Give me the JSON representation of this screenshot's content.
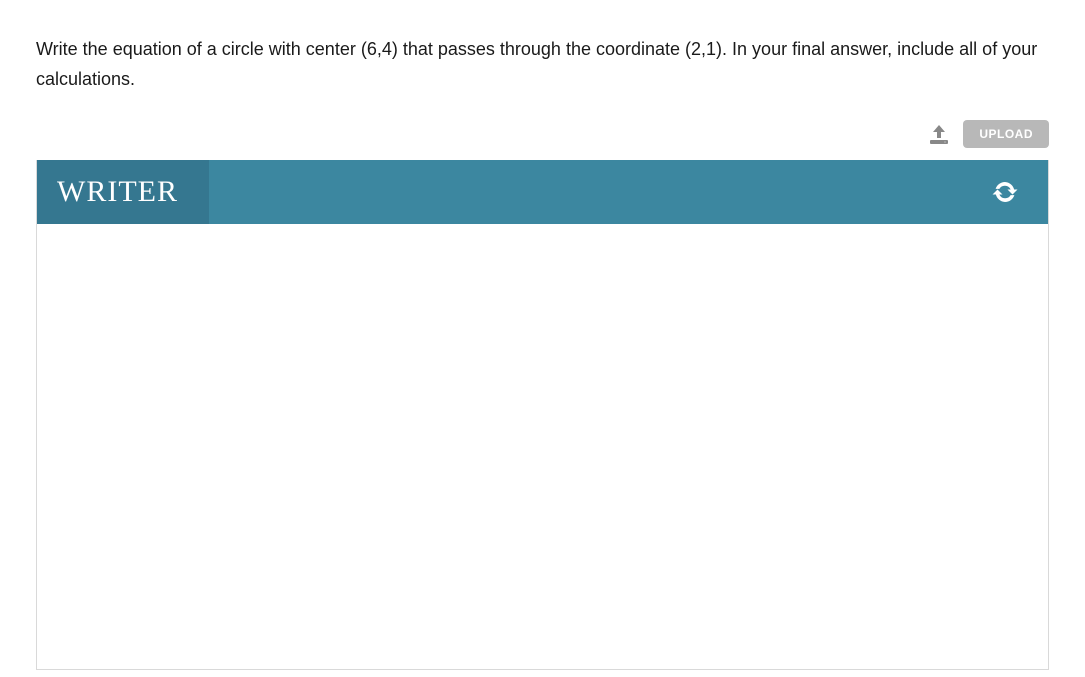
{
  "question": {
    "text": "Write the equation of a circle with center (6,4) that passes through the coordinate (2,1). In your final answer, include all of your calculations."
  },
  "upload": {
    "button_label": "UPLOAD"
  },
  "writer": {
    "tab_label": "WRITER",
    "content": ""
  }
}
